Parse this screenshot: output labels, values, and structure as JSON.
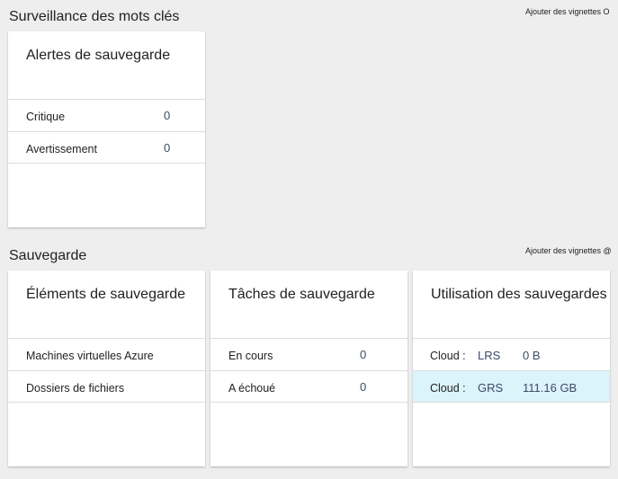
{
  "sections": {
    "monitoring": {
      "title": "Surveillance des mots clés",
      "add_tiles": "Ajouter des vignettes O"
    },
    "backup": {
      "title": "Sauvegarde",
      "add_tiles": "Ajouter des vignettes @"
    }
  },
  "alerts_tile": {
    "title": "Alertes de sauvegarde",
    "rows": [
      {
        "label": "Critique",
        "value": "0"
      },
      {
        "label": "Avertissement",
        "value": "0"
      }
    ]
  },
  "items_tile": {
    "title": "Éléments de sauvegarde",
    "rows": [
      {
        "label": "Machines virtuelles Azure"
      },
      {
        "label": "Dossiers de fichiers"
      }
    ]
  },
  "jobs_tile": {
    "title": "Tâches de sauvegarde",
    "rows": [
      {
        "label": "En cours",
        "value": "0"
      },
      {
        "label": "A échoué",
        "value": "0"
      }
    ]
  },
  "usage_tile": {
    "title": "Utilisation des sauvegardes",
    "rows": [
      {
        "label": "Cloud :",
        "kind": "LRS",
        "amount": "0 B"
      },
      {
        "label": "Cloud :",
        "kind": "GRS",
        "amount": "111.16 GB"
      }
    ]
  },
  "colors": {
    "highlight": "#dbf3fb",
    "value_text": "#3b4a66"
  }
}
